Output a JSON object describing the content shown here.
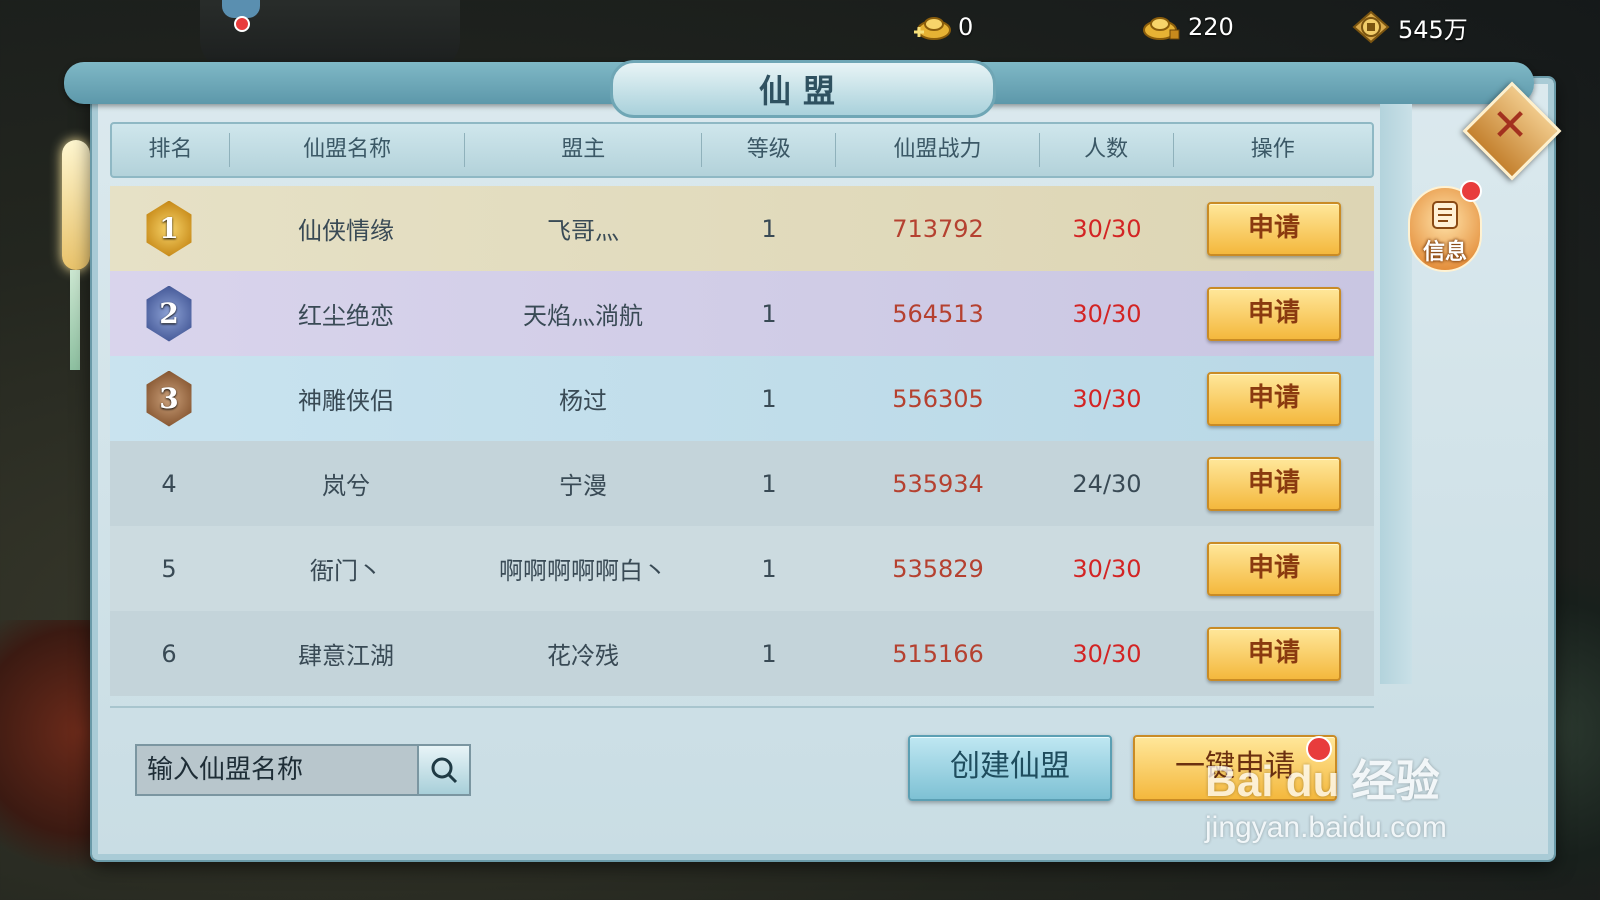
{
  "currencies": [
    {
      "icon": "gold-ingot-add-icon",
      "value": "0"
    },
    {
      "icon": "locked-gold-ingot-icon",
      "value": "220"
    },
    {
      "icon": "copper-coin-icon",
      "value": "545万"
    }
  ],
  "panel": {
    "title": "仙盟",
    "headers": [
      "排名",
      "仙盟名称",
      "盟主",
      "等级",
      "仙盟战力",
      "人数",
      "操作"
    ],
    "rows": [
      {
        "rank": "1",
        "name": "仙侠情缘",
        "leader": "飞哥灬",
        "level": "1",
        "power": "713792",
        "members": "30/30",
        "action": "申请"
      },
      {
        "rank": "2",
        "name": "红尘绝恋",
        "leader": "天焰灬淌航",
        "level": "1",
        "power": "564513",
        "members": "30/30",
        "action": "申请"
      },
      {
        "rank": "3",
        "name": "神雕侠侣",
        "leader": "杨过",
        "level": "1",
        "power": "556305",
        "members": "30/30",
        "action": "申请"
      },
      {
        "rank": "4",
        "name": "岚兮",
        "leader": "宁漫",
        "level": "1",
        "power": "535934",
        "members": "24/30",
        "action": "申请"
      },
      {
        "rank": "5",
        "name": "衙门丶",
        "leader": "啊啊啊啊啊白丶",
        "level": "1",
        "power": "535829",
        "members": "30/30",
        "action": "申请"
      },
      {
        "rank": "6",
        "name": "肆意江湖",
        "leader": "花冷残",
        "level": "1",
        "power": "515166",
        "members": "30/30",
        "action": "申请"
      }
    ],
    "search": {
      "placeholder": "输入仙盟名称"
    },
    "create_label": "创建仙盟",
    "onekey_label": "一键申请"
  },
  "side": {
    "info_label": "信息"
  },
  "watermark": {
    "text": "Bai du 经验",
    "url": "jingyan.baidu.com"
  },
  "colors": {
    "power": "#b54130",
    "full": "#d32424",
    "apply_button": "#f4b83d",
    "create_button": "#7ec1d4"
  }
}
